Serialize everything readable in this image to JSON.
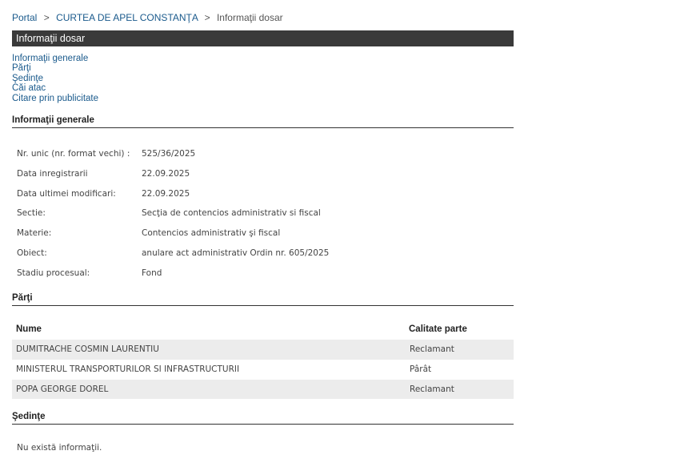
{
  "breadcrumb": {
    "portal": "Portal",
    "sep1": ">",
    "court": "CURTEA DE APEL CONSTANŢA",
    "sep2": ">",
    "current": "Informaţii dosar"
  },
  "title": "Informaţii dosar",
  "anchors": [
    "Informaţii generale",
    "Părţi",
    "Şedinţe",
    "Căi atac",
    "Citare prin publicitate"
  ],
  "general": {
    "heading": "Informaţii generale",
    "rows": [
      {
        "label": "Nr. unic (nr. format vechi) :",
        "value": "525/36/2025"
      },
      {
        "label": "Data inregistrarii",
        "value": "22.09.2025"
      },
      {
        "label": "Data ultimei modificari:",
        "value": "22.09.2025"
      },
      {
        "label": "Sectie:",
        "value": "Secţia de contencios administrativ si fiscal"
      },
      {
        "label": "Materie:",
        "value": "Contencios administrativ şi fiscal"
      },
      {
        "label": "Obiect:",
        "value": "anulare act administrativ Ordin nr. 605/2025"
      },
      {
        "label": "Stadiu procesual:",
        "value": "Fond"
      }
    ]
  },
  "parties": {
    "heading": "Părţi",
    "columns": [
      "Nume",
      "Calitate parte"
    ],
    "rows": [
      {
        "name": "DUMITRACHE COSMIN LAURENTIU",
        "role": "Reclamant"
      },
      {
        "name": "MINISTERUL TRANSPORTURILOR SI INFRASTRUCTURII",
        "role": "Pârât"
      },
      {
        "name": "POPA GEORGE DOREL",
        "role": "Reclamant"
      }
    ]
  },
  "hearings": {
    "heading": "Şedinţe",
    "empty_text": "Nu există informaţii."
  }
}
